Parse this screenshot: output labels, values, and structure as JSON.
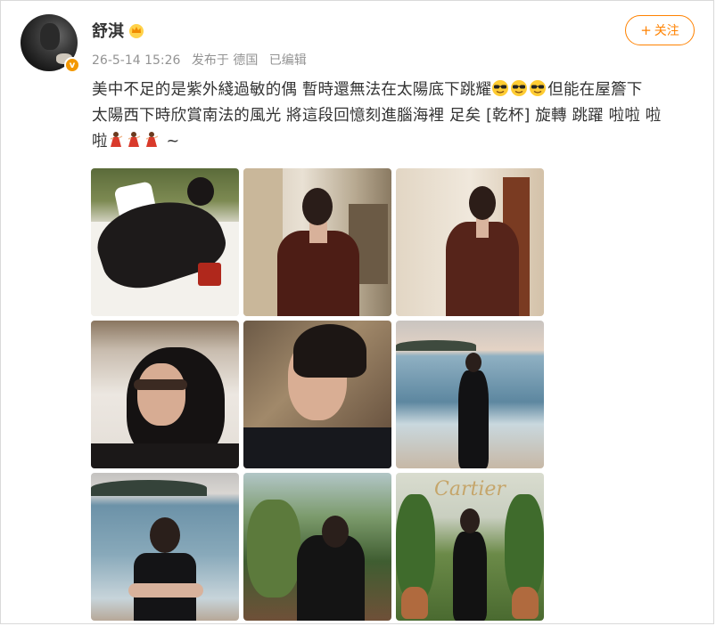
{
  "user": {
    "name": "舒淇",
    "avatar_icon": "avatar-photo",
    "badge_icon": "verified-v-icon",
    "badge_text": "v",
    "crown_icon": "crown-icon",
    "badge_color": "#f39800"
  },
  "meta": {
    "time": "26-5-14 15:26",
    "source": "发布于 德国",
    "edited": "已编辑"
  },
  "follow_button": {
    "plus": "+",
    "label": "关注",
    "color": "#ff8200"
  },
  "post": {
    "line1_text": "美中不足的是紫外綫過敏的偶 暫時還無法在太陽底下跳耀",
    "line1_emojis": [
      "sunglasses-emoji",
      "sunglasses-emoji",
      "sunglasses-emoji"
    ],
    "line1_tail": "但能在屋簷下",
    "line2_text": "太陽西下時欣賞南法的風光 將這段回憶刻進腦海裡 足矣 [乾杯] 旋轉 跳躍 啦啦 啦",
    "line3_text": "啦",
    "line3_emojis": [
      "dancer-emoji",
      "dancer-emoji",
      "dancer-emoji"
    ],
    "line3_tail": " ~"
  },
  "photos": [
    {
      "name": "photo-bed-lounging"
    },
    {
      "name": "photo-brown-suit-interior"
    },
    {
      "name": "photo-brown-suit-standing"
    },
    {
      "name": "photo-sunglasses-portrait"
    },
    {
      "name": "photo-closeup-portrait"
    },
    {
      "name": "photo-beach-standing"
    },
    {
      "name": "photo-beach-seated"
    },
    {
      "name": "photo-garden-phone"
    },
    {
      "name": "photo-cartier-event",
      "brand_text": "Cartier"
    }
  ]
}
